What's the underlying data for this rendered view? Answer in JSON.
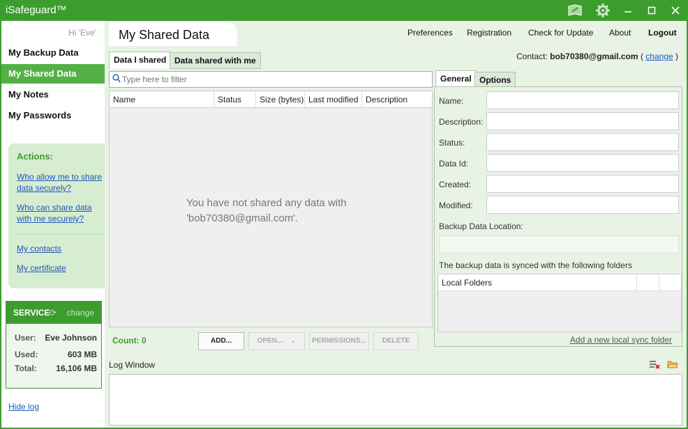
{
  "app": {
    "title": "iSafeguard™"
  },
  "titlebar_icons": [
    "book-icon",
    "gear-icon",
    "minimize-icon",
    "maximize-icon",
    "close-icon"
  ],
  "sidebar": {
    "greeting": "Hi 'Eve'",
    "items": [
      {
        "label": "My Backup Data",
        "active": false
      },
      {
        "label": "My Shared Data",
        "active": true
      },
      {
        "label": "My Notes",
        "active": false
      },
      {
        "label": "My Passwords",
        "active": false
      }
    ],
    "actions": {
      "title": "Actions:",
      "links": [
        "Who allow me to share data securely?",
        "Who can share data with me securely?",
        "My contacts",
        "My certificate"
      ]
    },
    "service": {
      "title": "SERVICE",
      "change": "change",
      "user_label": "User:",
      "user": "Eve Johnson",
      "used_label": "Used:",
      "used": "603 MB",
      "total_label": "Total:",
      "total": "16,106 MB"
    },
    "hide_log": "Hide log"
  },
  "header": {
    "page_title": "My Shared Data",
    "menu": [
      "Preferences",
      "Registration",
      "Check for Update",
      "About",
      "Logout"
    ],
    "contact_label": "Contact:",
    "contact_email": "bob70380@gmail.com",
    "contact_open": "(",
    "contact_change": "change",
    "contact_close": ")"
  },
  "tabs": [
    "Data I shared",
    "Data shared with me"
  ],
  "filter": {
    "placeholder": "Type here to filter"
  },
  "grid": {
    "columns": [
      "Name",
      "Status",
      "Size (bytes)",
      "Last modified",
      "Description"
    ],
    "empty_message": "You have not shared any data with 'bob70380@gmail.com'."
  },
  "footer": {
    "count": "Count: 0",
    "buttons": {
      "add": "ADD...",
      "open": "OPEN...",
      "permissions": "PERMISSIONS...",
      "delete": "DELETE"
    }
  },
  "details": {
    "tabs": [
      "General",
      "Options"
    ],
    "fields": [
      "Name:",
      "Description:",
      "Status:",
      "Data Id:",
      "Created:",
      "Modified:"
    ],
    "backup_location_label": "Backup Data Location:",
    "sync_note": "The backup data is synced with the following folders",
    "folders_header": "Local Folders",
    "add_sync": "Add a new local sync folder"
  },
  "log": {
    "title": "Log Window"
  },
  "colors": {
    "brand": "#3c9d2e",
    "active_nav": "#54b046",
    "link": "#1f58b8"
  }
}
